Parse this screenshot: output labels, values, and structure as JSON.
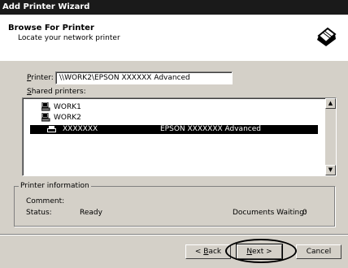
{
  "window": {
    "title": "Add Printer Wizard"
  },
  "header": {
    "title": "Browse For Printer",
    "subtitle": "Locate your network printer",
    "icon": "printer-wizard-icon"
  },
  "printer_field": {
    "label_prefix": "",
    "label_underlined": "P",
    "label_rest": "rinter:",
    "value": "\\\\WORK2\\EPSON XXXXXX Advanced"
  },
  "shared_printers": {
    "label_underlined": "S",
    "label_rest": "hared printers:",
    "items": [
      {
        "name": "WORK1",
        "type": "computer"
      },
      {
        "name": "WORK2",
        "type": "computer"
      }
    ],
    "selected": {
      "name": "XXXXXXX",
      "description": "EPSON XXXXXXX Advanced"
    }
  },
  "printer_info": {
    "title": "Printer information",
    "comment_label": "Comment:",
    "comment_value": "",
    "status_label": "Status:",
    "status_value": "Ready",
    "documents_label": "Documents Waiting:",
    "documents_value": "0"
  },
  "buttons": {
    "back_prefix": "< ",
    "back_underlined": "B",
    "back_rest": "ack",
    "next_underlined": "N",
    "next_rest": "ext >",
    "cancel": "Cancel"
  }
}
